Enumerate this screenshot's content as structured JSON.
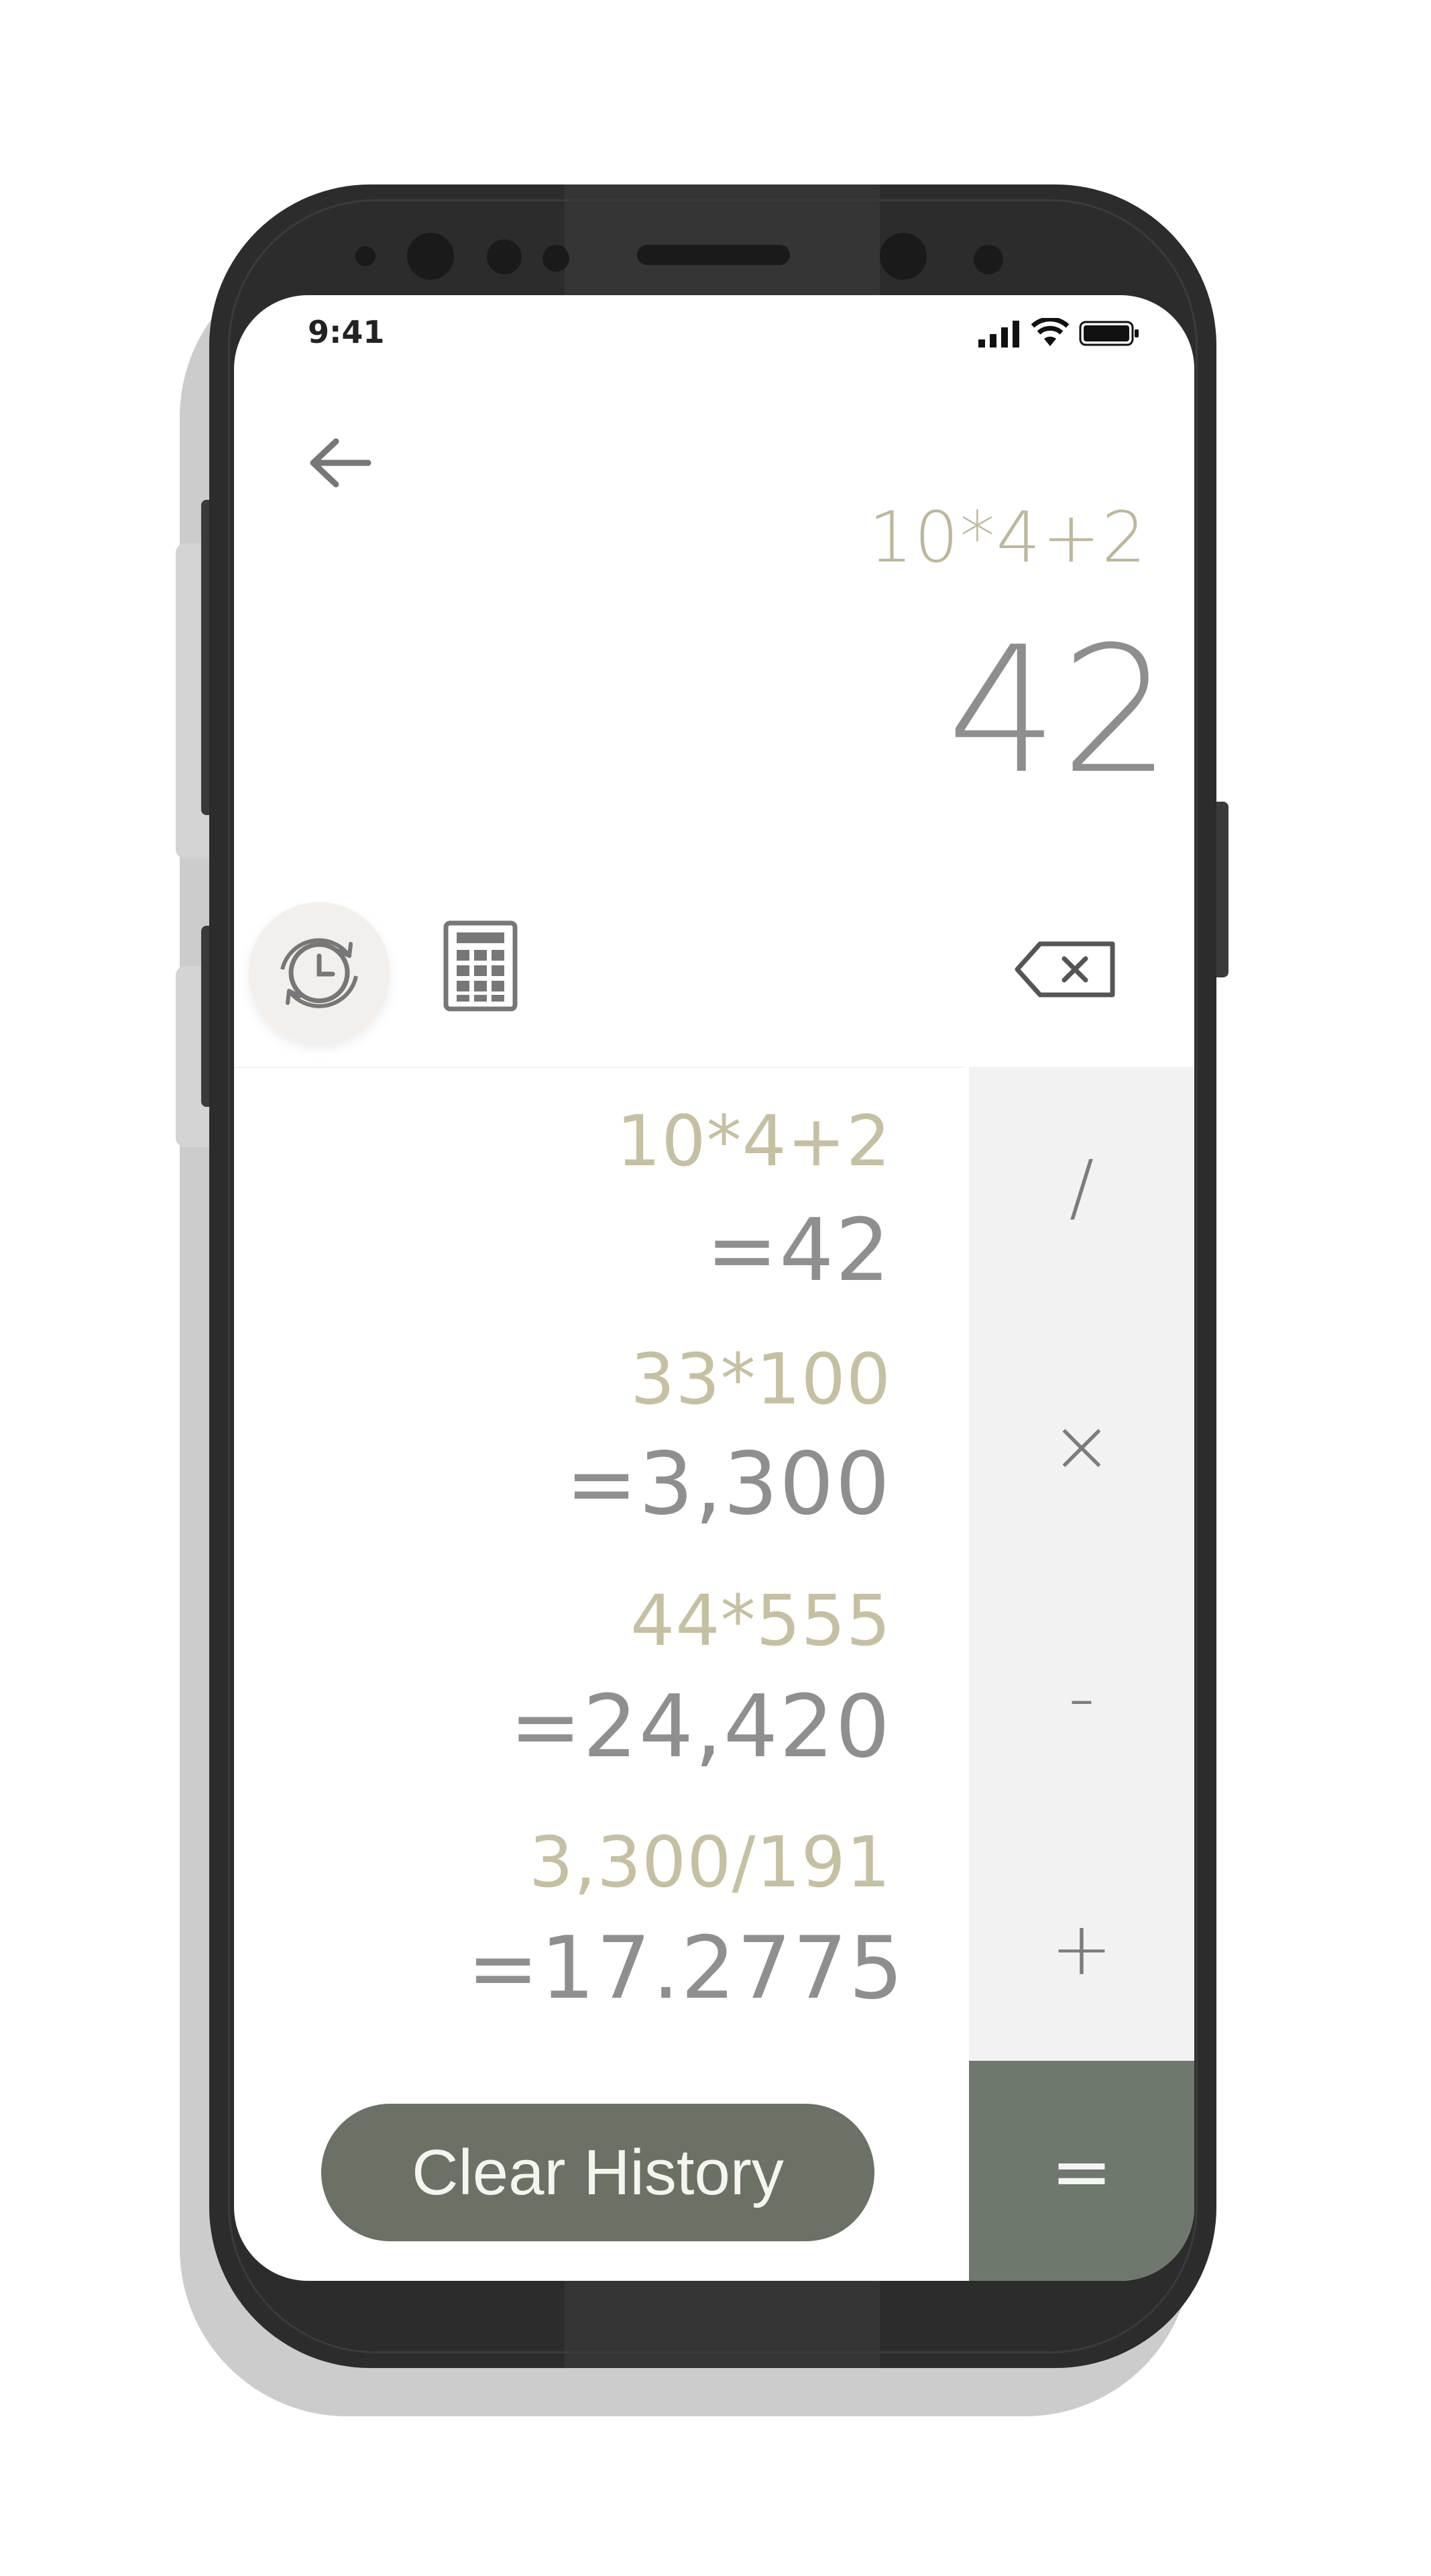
{
  "status_bar": {
    "time": "9:41"
  },
  "calculator": {
    "expression": "10*4+2",
    "result": "42"
  },
  "history": [
    {
      "expression": "10*4+2",
      "result": "=42"
    },
    {
      "expression": "33*100",
      "result": "=3,300"
    },
    {
      "expression": "44*555",
      "result": "=24,420"
    },
    {
      "expression": "3,300/191",
      "result": "=17.2775"
    }
  ],
  "operators": {
    "divide": "/",
    "multiply": "×",
    "subtract": "-",
    "add": "+",
    "equals": "="
  },
  "clear_history_label": "Clear History",
  "colors": {
    "expression": "#bdb89b",
    "result": "#8e8e8e",
    "accent": "#6b7164",
    "operator_panel": "#f2f2f2"
  },
  "icons": {
    "back": "arrow-left-icon",
    "history": "history-clock-icon",
    "calculator": "calculator-icon",
    "backspace": "backspace-icon"
  }
}
